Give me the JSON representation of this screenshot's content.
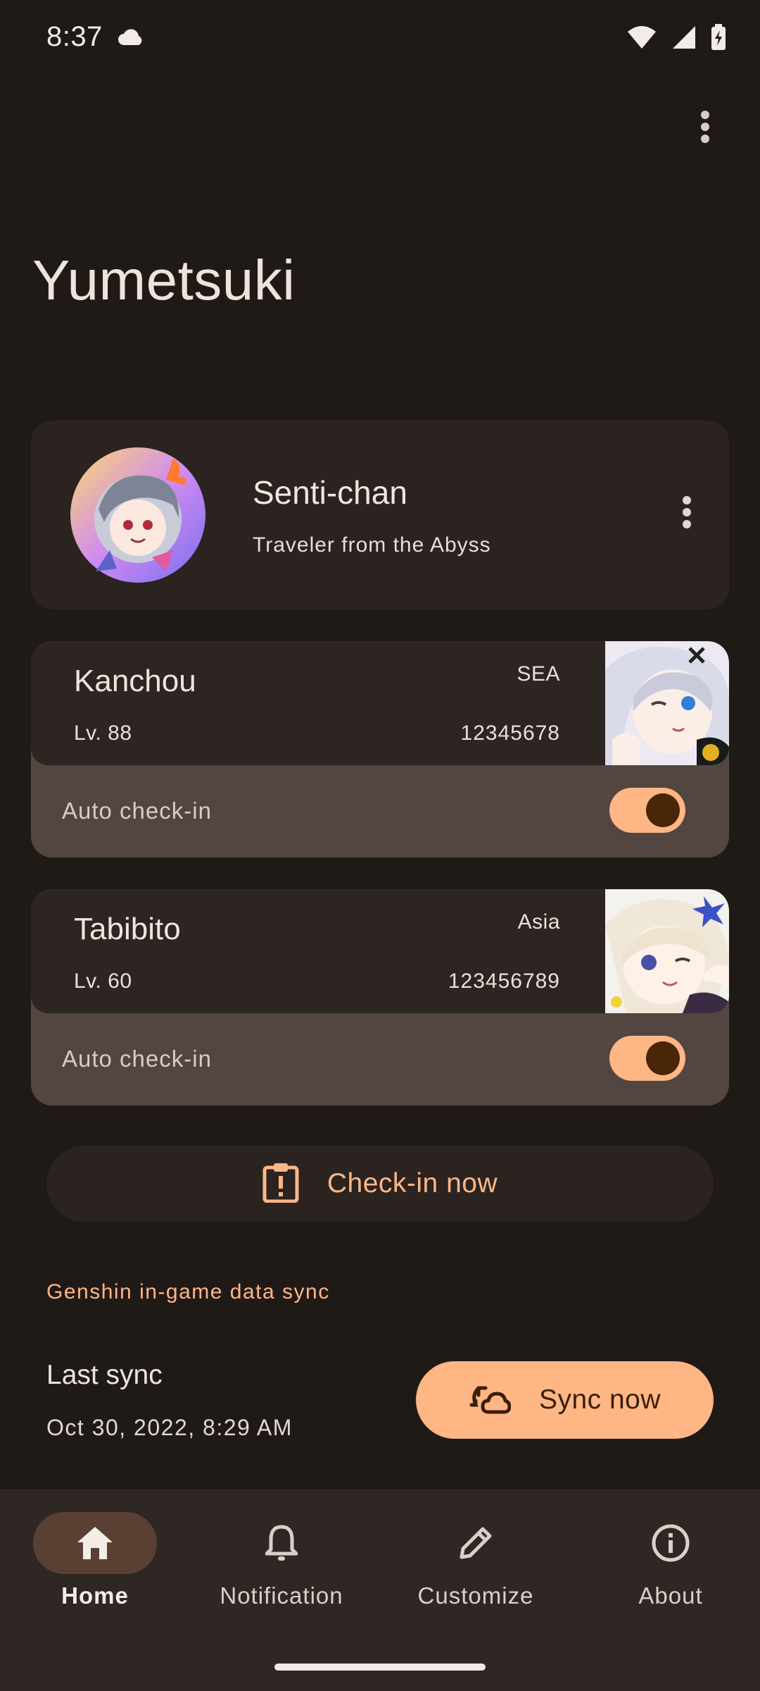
{
  "status_bar": {
    "time": "8:37",
    "icons": [
      "cloud-icon",
      "wifi-icon",
      "signal-icon",
      "battery-charging-icon"
    ]
  },
  "app": {
    "title": "Yumetsuki",
    "overflow_icon": "more-vert-icon"
  },
  "profile": {
    "name": "Senti-chan",
    "signature": "Traveler from the Abyss",
    "menu_icon": "more-vert-icon"
  },
  "accounts": [
    {
      "name": "Kanchou",
      "region": "SEA",
      "level": "Lv. 88",
      "uid": "12345678",
      "auto_checkin_label": "Auto check-in",
      "auto_checkin_enabled": true
    },
    {
      "name": "Tabibito",
      "region": "Asia",
      "level": "Lv. 60",
      "uid": "123456789",
      "auto_checkin_label": "Auto check-in",
      "auto_checkin_enabled": true
    }
  ],
  "checkin": {
    "label": "Check-in now",
    "icon": "clipboard-alert-icon"
  },
  "sync": {
    "section_header": "Genshin in-game data sync",
    "last_sync_title": "Last sync",
    "last_sync_time": "Oct 30, 2022, 8:29 AM",
    "button_label": "Sync now",
    "button_icon": "sync-icon"
  },
  "bottom_nav": {
    "items": [
      {
        "label": "Home",
        "icon": "home-icon",
        "active": true
      },
      {
        "label": "Notification",
        "icon": "bell-icon",
        "active": false
      },
      {
        "label": "Customize",
        "icon": "pencil-icon",
        "active": false
      },
      {
        "label": "About",
        "icon": "info-icon",
        "active": false
      }
    ]
  },
  "colors": {
    "background": "#201a17",
    "card": "#2a2320",
    "card_bottom": "#534540",
    "accent": "#ffb685",
    "on_accent": "#3a1f0a"
  }
}
